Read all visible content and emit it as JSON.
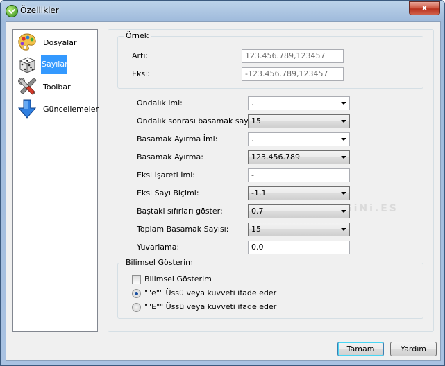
{
  "window": {
    "title": "Özellikler",
    "close_label": "x"
  },
  "sidebar": {
    "items": [
      {
        "label": "Dosyalar",
        "icon": "palette-icon",
        "selected": false
      },
      {
        "label": "Sayılar",
        "icon": "dice-icon",
        "selected": true
      },
      {
        "label": "Toolbar",
        "icon": "tools-icon",
        "selected": false
      },
      {
        "label": "Güncellemeler",
        "icon": "download-arrow-icon",
        "selected": false
      }
    ]
  },
  "example": {
    "legend": "Örnek",
    "positive_label": "Artı:",
    "positive_value": "123.456.789,123457",
    "negative_label": "Eksi:",
    "negative_value": "-123.456.789,123457"
  },
  "settings": {
    "decimal_sep_label": "Ondalık imi:",
    "decimal_sep_value": ".",
    "decimal_places_label": "Ondalık sonrası basamak sayısı:",
    "decimal_places_value": "15",
    "group_sep_label": "Basamak Ayırma İmi:",
    "group_sep_value": ".",
    "grouping_label": "Basamak Ayırma:",
    "grouping_value": "123.456.789",
    "neg_sign_label": "Eksi İşareti İmi:",
    "neg_sign_value": "-",
    "neg_format_label": "Eksi Sayı Biçimi:",
    "neg_format_value": "-1.1",
    "leading_zero_label": "Baştaki sıfırları göster:",
    "leading_zero_value": "0.7",
    "total_digits_label": "Toplam Basamak Sayısı:",
    "total_digits_value": "15",
    "rounding_label": "Yuvarlama:",
    "rounding_value": "0.0"
  },
  "scientific": {
    "legend": "Bilimsel Gösterim",
    "checkbox_label": "Bilimsel Gösterim",
    "checked": false,
    "radio1_label": "\"\"e\"\" Üssü veya kuvveti ifade eder",
    "radio1_selected": true,
    "radio2_label": "\"\"E\"\" Üssü veya kuvveti ifade eder",
    "radio2_selected": false
  },
  "buttons": {
    "ok": "Tamam",
    "help": "Yardım"
  },
  "watermark": "CEPGiNi.ES"
}
